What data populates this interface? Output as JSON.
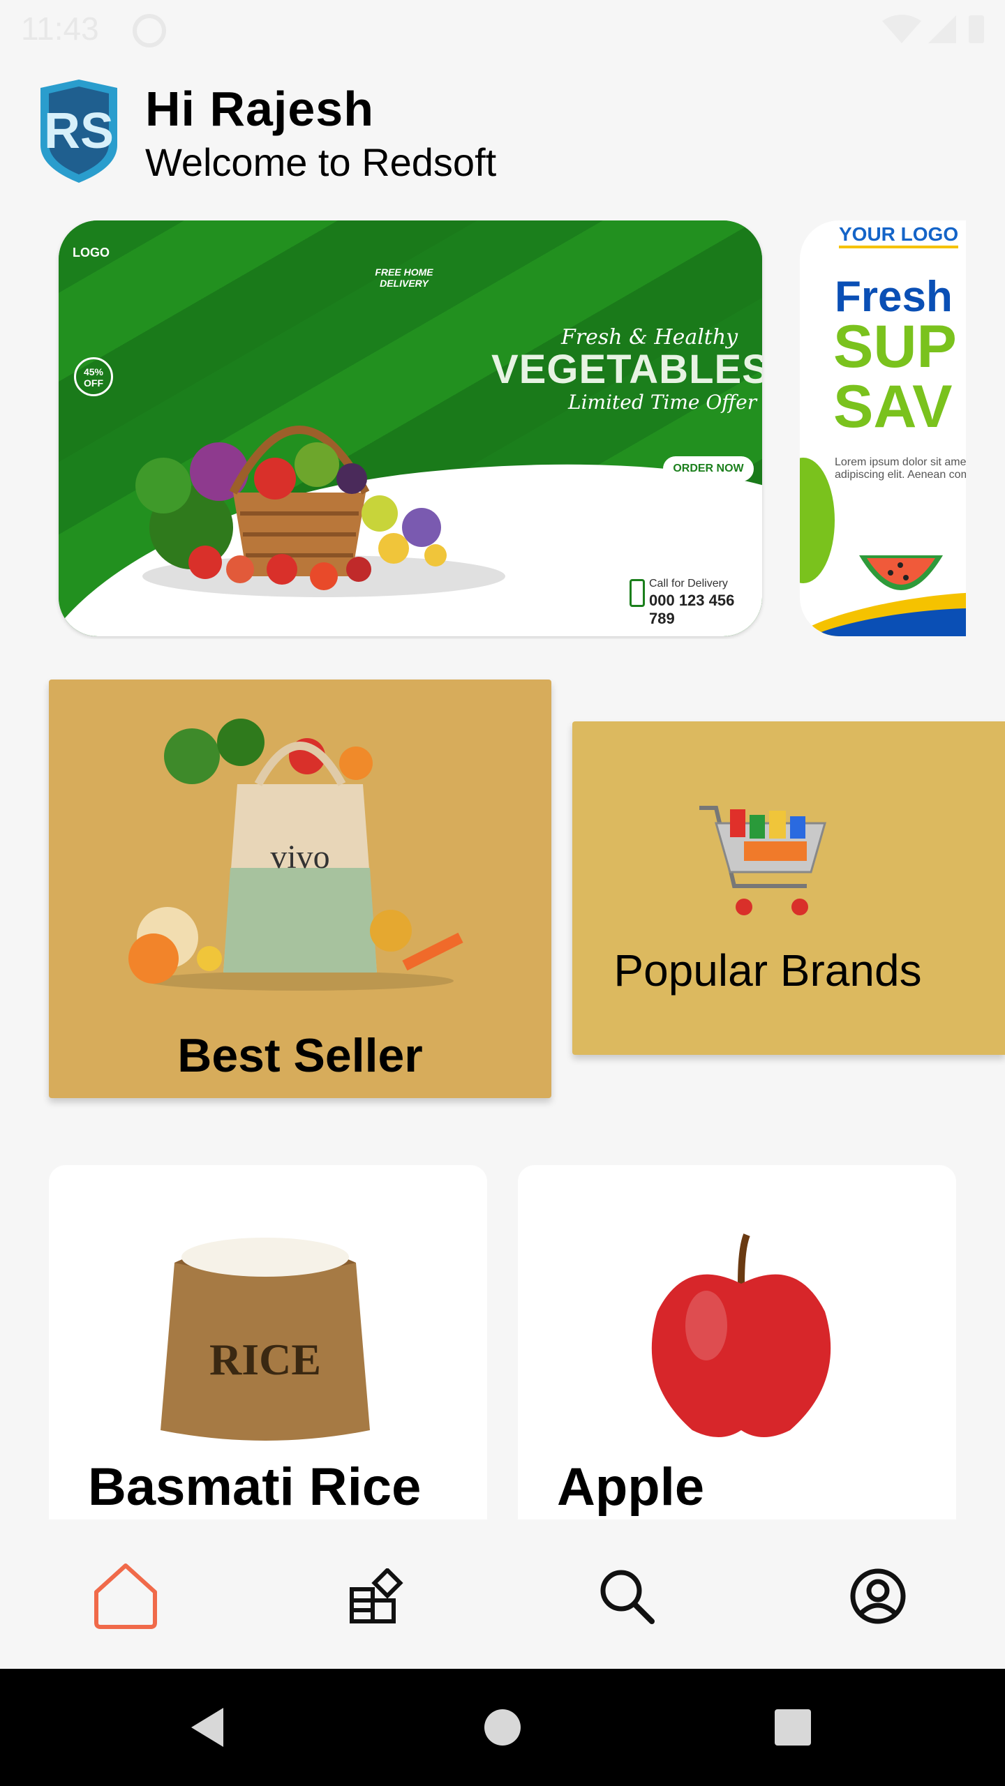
{
  "status_bar": {
    "time": "11:43"
  },
  "header": {
    "logo_text": "RS",
    "greeting": "Hi Rajesh",
    "welcome": "Welcome to Redsoft"
  },
  "banners": [
    {
      "logo": "LOGO",
      "free_delivery": "FREE HOME DELIVERY",
      "discount": "45% OFF",
      "tagline": "Fresh & Healthy",
      "headline": "VEGETABLES",
      "subline": "Limited Time Offer",
      "cta": "ORDER NOW",
      "call_label": "Call for Delivery",
      "phone": "000 123 456 789"
    },
    {
      "logo": "YOUR LOGO",
      "line1": "Fresh",
      "line2": "SUP",
      "line3": "SAV",
      "body": "Lorem ipsum dolor sit amet adipiscing elit. Aenean com"
    }
  ],
  "categories": [
    {
      "label": "Best Seller"
    },
    {
      "label": "Popular Brands"
    }
  ],
  "products": [
    {
      "name": "Basmati Rice",
      "image_text": "RICE"
    },
    {
      "name": "Apple"
    }
  ],
  "bottom_nav": [
    {
      "icon": "home-icon",
      "active": true
    },
    {
      "icon": "categories-icon"
    },
    {
      "icon": "search-icon"
    },
    {
      "icon": "profile-icon"
    }
  ],
  "colors": {
    "background": "#f6f6f6",
    "best_seller_card": "#d7ac5b",
    "popular_brands_card": "#dcb95f",
    "active_nav": "#f06a4a",
    "banner_green": "#1f8b1f"
  }
}
